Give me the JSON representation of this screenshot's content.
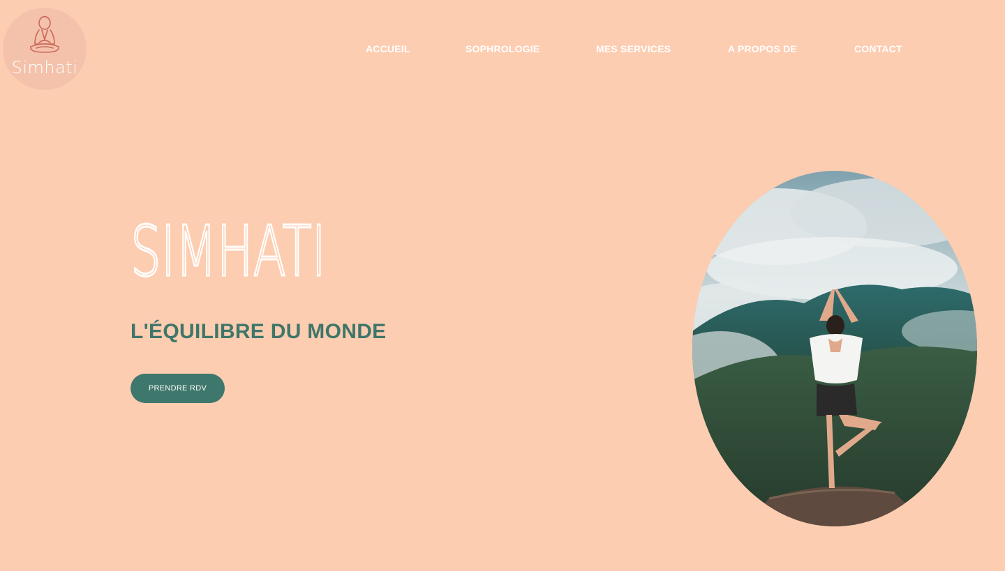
{
  "logo": {
    "text": "Simhati",
    "icon": "meditating-buddha-icon"
  },
  "nav": {
    "items": [
      {
        "label": "ACCUEIL"
      },
      {
        "label": "SOPHROLOGIE"
      },
      {
        "label": "MES SERVICES"
      },
      {
        "label": "A PROPOS DE"
      },
      {
        "label": "CONTACT"
      }
    ]
  },
  "hero": {
    "title": "SIMHATI",
    "tagline": "L'ÉQUILIBRE DU MONDE",
    "cta_label": "PRENDRE RDV",
    "image": "yoga-woman-mountain-photo"
  },
  "colors": {
    "background": "#FDCDB1",
    "accent": "#3E776C",
    "logo_circle": "#F4C2AA",
    "text_light": "#FFFFFF"
  }
}
